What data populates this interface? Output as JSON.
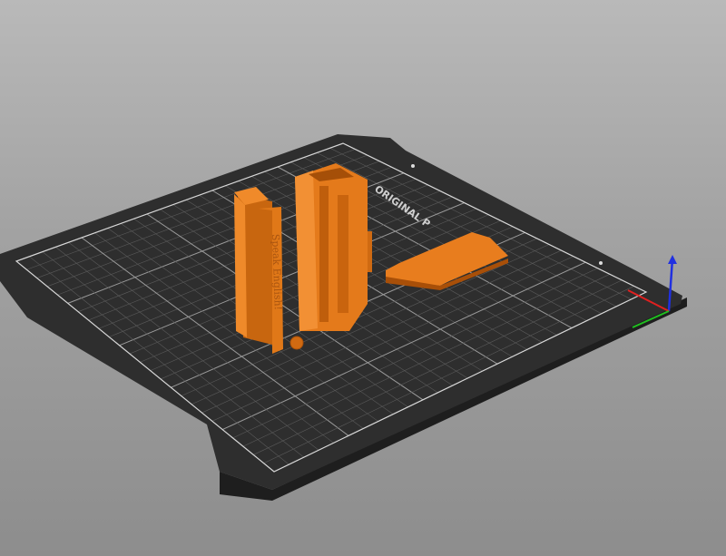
{
  "viewport": {
    "bed_label": "ORIGINAL P",
    "object_text": "Speak English!",
    "colors": {
      "background": "#a8a8a8",
      "bed": "#2e2e2e",
      "grid": "#6a6a6a",
      "object": "#e57a1a",
      "object_shade": "#b85a0c",
      "axis_x": "#e02020",
      "axis_y": "#20c020",
      "axis_z": "#2030e0"
    }
  }
}
